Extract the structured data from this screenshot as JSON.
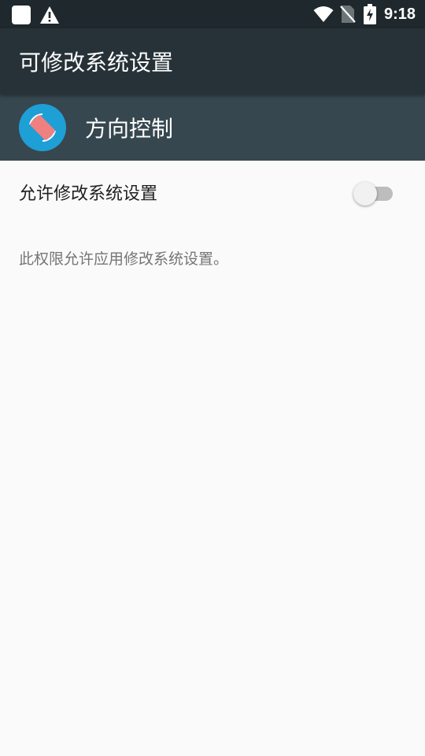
{
  "status_bar": {
    "time": "9:18",
    "left_icons": [
      "notification-square-icon",
      "warning-icon"
    ],
    "right_icons": [
      "wifi-icon",
      "no-sim-icon",
      "battery-charging-icon"
    ]
  },
  "toolbar": {
    "title": "可修改系统设置"
  },
  "app": {
    "name": "方向控制",
    "icon": "screen-rotation-icon",
    "icon_bg_color": "#1e9fd6",
    "icon_fg_color": "#f08080"
  },
  "setting": {
    "label": "允许修改系统设置",
    "enabled": false
  },
  "description": "此权限允许应用修改系统设置。",
  "colors": {
    "status_bar": "#1f282c",
    "toolbar": "#263238",
    "app_header": "#37474f",
    "background": "#fafafa"
  }
}
